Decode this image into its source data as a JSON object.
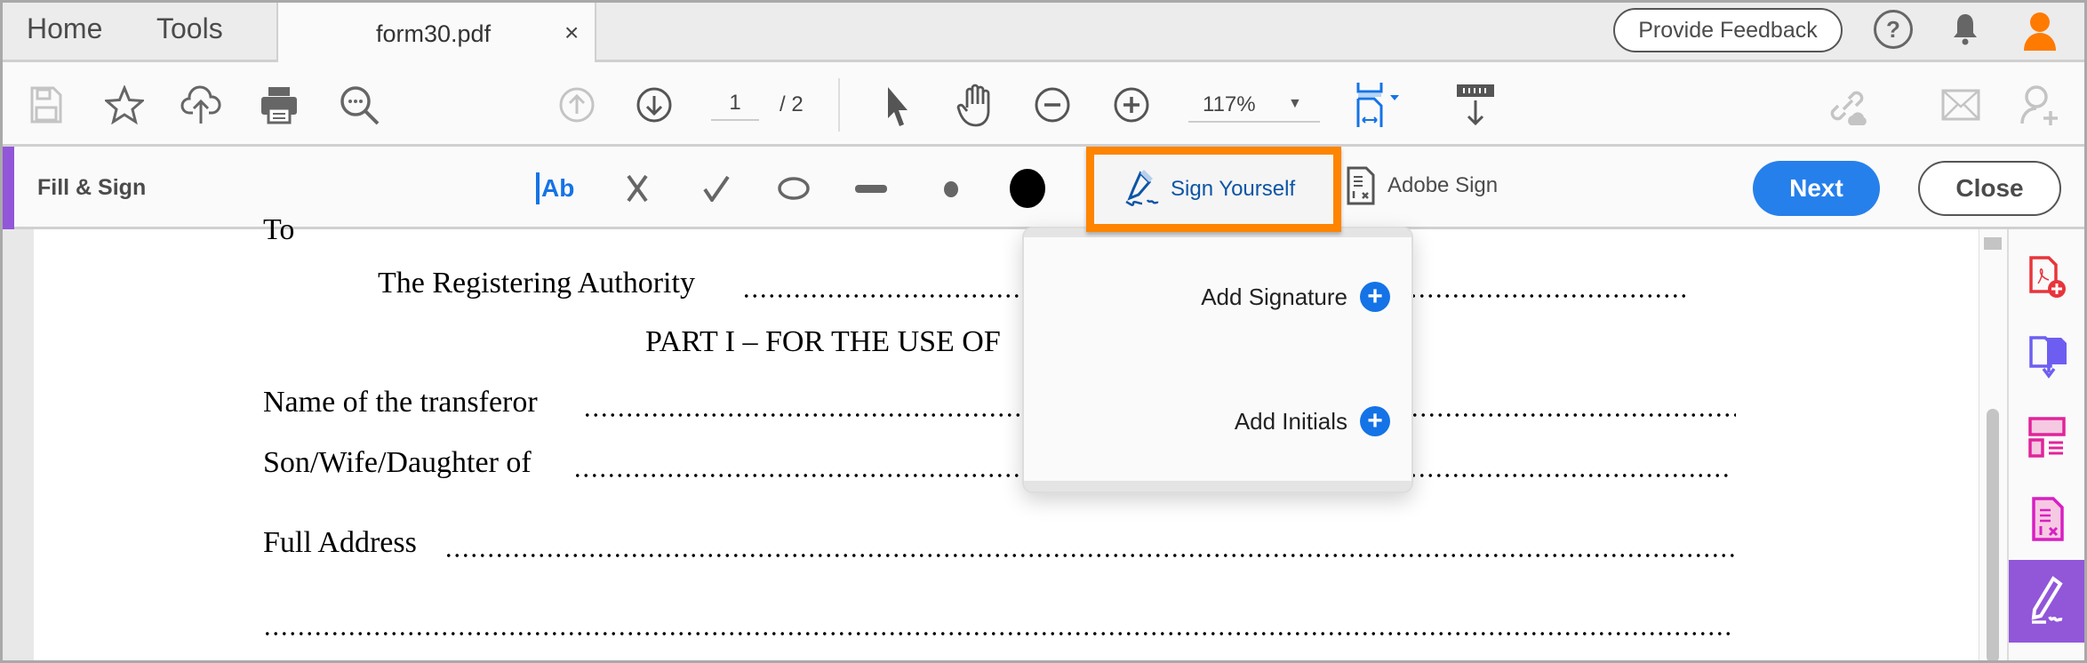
{
  "tabs": {
    "home": "Home",
    "tools": "Tools",
    "document": "form30.pdf",
    "close_glyph": "×"
  },
  "header": {
    "feedback": "Provide Feedback",
    "help_glyph": "?"
  },
  "toolbar": {
    "page_current": "1",
    "page_total": "/ 2",
    "zoom": "117%"
  },
  "fill_sign": {
    "title": "Fill & Sign",
    "text_tool": "Ab",
    "sign_yourself": "Sign Yourself",
    "adobe_sign": "Adobe Sign",
    "next": "Next",
    "close": "Close"
  },
  "popup": {
    "add_signature": "Add Signature",
    "add_initials": "Add Initials"
  },
  "document": {
    "to": "To",
    "authority": "The Registering Authority",
    "part": "PART I – FOR THE USE OF",
    "transferor": "Name of the transferor",
    "relation": "Son/Wife/Daughter of",
    "address": "Full Address"
  },
  "colors": {
    "accent": "#2680eb",
    "fill_sign": "#9256d9",
    "highlight": "#ff8400"
  }
}
